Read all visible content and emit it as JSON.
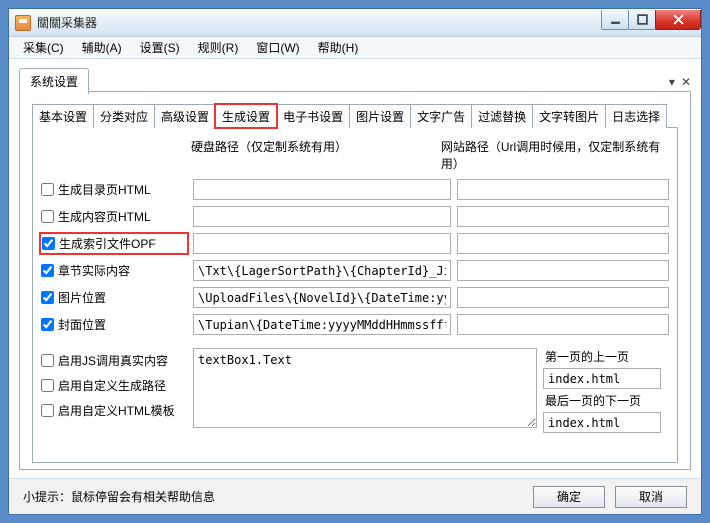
{
  "window": {
    "title": "關關采集器"
  },
  "menu": {
    "collect": "采集(C)",
    "assist": "辅助(A)",
    "settings": "设置(S)",
    "rules": "规则(R)",
    "window": "窗口(W)",
    "help": "帮助(H)"
  },
  "outer_tab": {
    "label": "系统设置"
  },
  "inner_tabs": {
    "basic": "基本设置",
    "category": "分类对应",
    "advanced": "高级设置",
    "generate": "生成设置",
    "ebook": "电子书设置",
    "image": "图片设置",
    "textad": "文字广告",
    "filter": "过滤替换",
    "textimg": "文字转图片",
    "log": "日志选择"
  },
  "col_headers": {
    "disk": "硬盘路径（仅定制系统有用）",
    "site": "网站路径（Url调用时候用，仅定制系统有用）"
  },
  "rows": {
    "dir_html": {
      "label": "生成目录页HTML",
      "checked": false,
      "disk": "",
      "site": ""
    },
    "content_html": {
      "label": "生成内容页HTML",
      "checked": false,
      "disk": "",
      "site": ""
    },
    "index_opf": {
      "label": "生成索引文件OPF",
      "checked": true,
      "disk": "",
      "site": ""
    },
    "chapter": {
      "label": "章节实际内容",
      "checked": true,
      "disk": "\\Txt\\{LagerSortPath}\\{ChapterId}_Jie.Txt",
      "site": ""
    },
    "image_pos": {
      "label": "图片位置",
      "checked": true,
      "disk": "\\UploadFiles\\{NovelId}\\{DateTime:yyyyMMd",
      "site": ""
    },
    "cover_pos": {
      "label": "封面位置",
      "checked": true,
      "disk": "\\Tupian\\{DateTime:yyyyMMddHHmmssffff}.jp",
      "site": ""
    }
  },
  "lower": {
    "jscall": {
      "label": "启用JS调用真实内容",
      "checked": false
    },
    "custom_path": {
      "label": "启用自定义生成路径",
      "checked": false
    },
    "custom_tpl": {
      "label": "启用自定义HTML模板",
      "checked": false
    },
    "textarea": "textBox1.Text",
    "first_prev_label": "第一页的上一页",
    "first_prev_value": "index.html",
    "last_next_label": "最后一页的下一页",
    "last_next_value": "index.html"
  },
  "footer": {
    "hint": "小提示：鼠标停留会有相关帮助信息",
    "ok": "确定",
    "cancel": "取消"
  }
}
